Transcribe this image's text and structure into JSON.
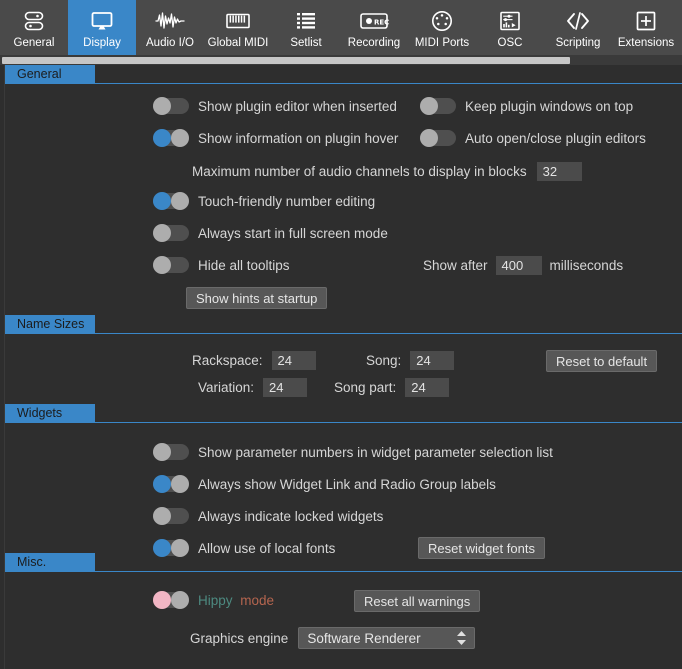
{
  "toolbar": {
    "items": [
      {
        "label": "General",
        "icon": "server-stack-icon",
        "active": false
      },
      {
        "label": "Display",
        "icon": "monitor-icon",
        "active": true
      },
      {
        "label": "Audio I/O",
        "icon": "waveform-icon",
        "active": false
      },
      {
        "label": "Global MIDI",
        "icon": "piano-keys-icon",
        "active": false
      },
      {
        "label": "Setlist",
        "icon": "list-icon",
        "active": false
      },
      {
        "label": "Recording",
        "icon": "rec-badge-icon",
        "active": false
      },
      {
        "label": "MIDI Ports",
        "icon": "midi-din-icon",
        "active": false
      },
      {
        "label": "OSC",
        "icon": "osc-panel-icon",
        "active": false
      },
      {
        "label": "Scripting",
        "icon": "code-brackets-icon",
        "active": false
      },
      {
        "label": "Extensions",
        "icon": "plus-box-icon",
        "active": false
      }
    ]
  },
  "sections": {
    "general": {
      "title": "General",
      "options": {
        "show_plugin_editor": {
          "label": "Show plugin editor when inserted",
          "state": "off"
        },
        "keep_plugin_on_top": {
          "label": "Keep plugin windows on top",
          "state": "off"
        },
        "show_info_hover": {
          "label": "Show information on plugin hover",
          "state": "on"
        },
        "auto_open_close_editors": {
          "label": "Auto open/close plugin editors",
          "state": "off"
        },
        "touch_friendly": {
          "label": "Touch-friendly number editing",
          "state": "on"
        },
        "full_screen": {
          "label": "Always start in full screen mode",
          "state": "off"
        },
        "hide_tooltips": {
          "label": "Hide all tooltips",
          "state": "off"
        }
      },
      "max_channels_label": "Maximum number of audio channels to display in blocks",
      "max_channels_value": "32",
      "show_after_label": "Show after",
      "show_after_value": "400",
      "milliseconds_label": "milliseconds",
      "show_hints_button": "Show hints at startup"
    },
    "name_sizes": {
      "title": "Name Sizes",
      "fields": [
        {
          "label": "Rackspace:",
          "value": "24"
        },
        {
          "label": "Song:",
          "value": "24"
        },
        {
          "label": "Variation:",
          "value": "24"
        },
        {
          "label": "Song part:",
          "value": "24"
        }
      ],
      "reset_button": "Reset to default"
    },
    "widgets": {
      "title": "Widgets",
      "options": {
        "show_param_numbers": {
          "label": "Show parameter numbers in widget parameter selection list",
          "state": "off"
        },
        "show_widget_link": {
          "label": "Always show Widget Link and Radio Group labels",
          "state": "on"
        },
        "indicate_locked": {
          "label": "Always indicate locked widgets",
          "state": "off"
        },
        "local_fonts": {
          "label": "Allow use of local fonts",
          "state": "on"
        }
      },
      "reset_fonts_button": "Reset widget fonts"
    },
    "misc": {
      "title": "Misc.",
      "hippy": {
        "word1": "Hippy",
        "word2": "mode",
        "state": "pink"
      },
      "reset_warnings_button": "Reset all warnings",
      "graphics_engine_label": "Graphics engine",
      "graphics_engine_value": "Software Renderer"
    }
  },
  "colors": {
    "accent": "#3a87c8",
    "toolbar_bg": "#4a4a4a",
    "page_bg": "#2e2e2e",
    "field_bg": "#4b4b4b",
    "button_bg": "#575757",
    "hippy_word1": "#4d8a80",
    "hippy_word2": "#b5654f",
    "toggle_pink": "#f2b6c4"
  }
}
